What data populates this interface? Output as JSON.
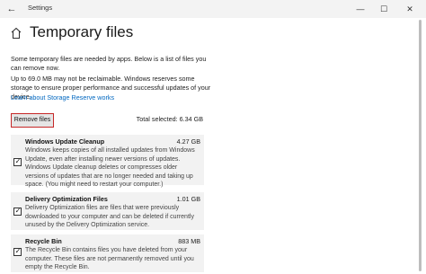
{
  "window": {
    "title": "Settings",
    "back_glyph": "←",
    "minimize_glyph": "—",
    "maximize_glyph": "☐",
    "close_glyph": "✕"
  },
  "page": {
    "title": "Temporary files",
    "intro": "Some temporary files are needed by apps. Below is a list of files you can remove now.",
    "storage_note": "Up to 69.0 MB may not be reclaimable. Windows reserves some storage to ensure proper performance and successful updates of your device.",
    "learn_more_link": "Learn about Storage Reserve works"
  },
  "actions": {
    "remove_files_label": "Remove files",
    "total_selected": "Total selected: 6.34 GB"
  },
  "categories": [
    {
      "name": "Windows Update Cleanup",
      "size": "4.27 GB",
      "checked": true,
      "description": "Windows keeps copies of all installed updates from Windows Update, even after installing newer versions of updates. Windows Update cleanup deletes or compresses older versions of updates that are no longer needed and taking up space. (You might need to restart your computer.)"
    },
    {
      "name": "Delivery Optimization Files",
      "size": "1.01 GB",
      "checked": true,
      "description": "Delivery Optimization files are files that were previously downloaded to your computer and can be deleted if currently unused by the Delivery Optimization service."
    },
    {
      "name": "Recycle Bin",
      "size": "883 MB",
      "checked": true,
      "description": "The Recycle Bin contains files you have deleted from your computer. These files are not permanently removed until you empty the Recycle Bin."
    }
  ],
  "icons": {
    "home": "home-icon",
    "checkmark": "checkmark-icon"
  },
  "colors": {
    "link": "#0067c0",
    "highlight_border": "#c62828",
    "category_bg": "#f2f2f2"
  }
}
